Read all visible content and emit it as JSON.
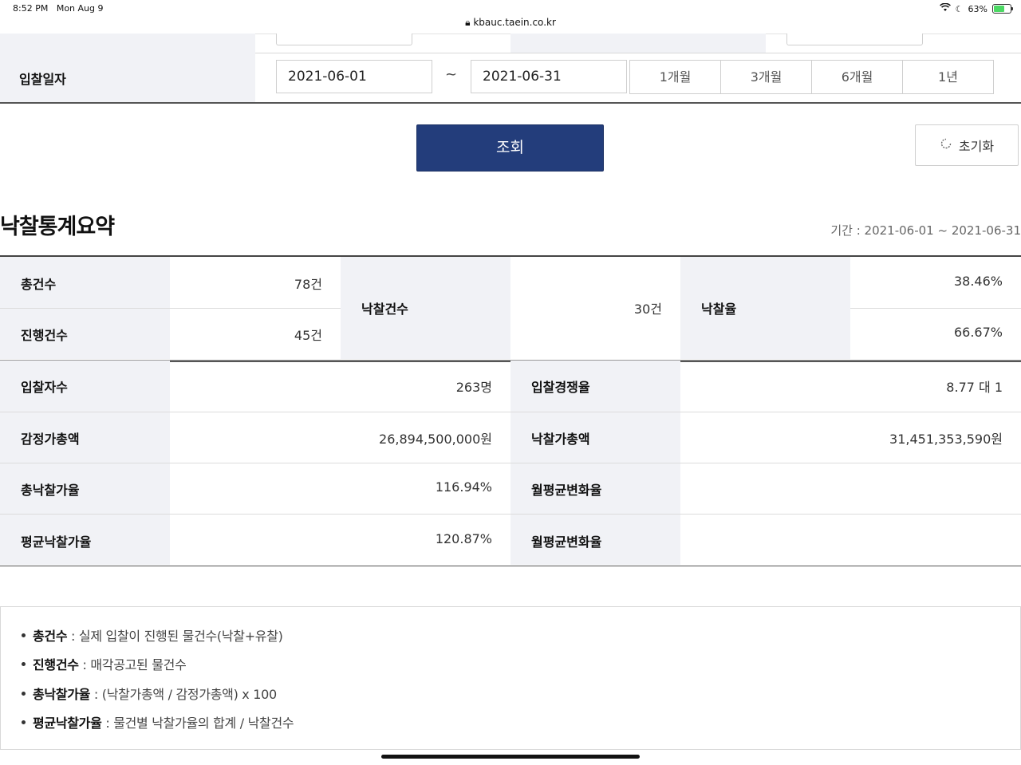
{
  "status_bar": {
    "time": "8:52 PM",
    "date": "Mon Aug 9",
    "url": "kbauc.taein.co.kr",
    "battery": "63%",
    "battery_level": 0.63
  },
  "filter": {
    "bid_date_label": "입찰일자",
    "start_date": "2021-06-01",
    "separator": "~",
    "end_date": "2021-06-31",
    "periods": [
      "1개월",
      "3개월",
      "6개월",
      "1년"
    ]
  },
  "actions": {
    "search_label": "조회",
    "reset_label": "초기화"
  },
  "summary": {
    "title": "낙찰통계요약",
    "period_label": "기간 : 2021-06-01 ~ 2021-06-31"
  },
  "table1": {
    "total_label": "총건수",
    "total_value": "78건",
    "progress_label": "진행건수",
    "progress_value": "45건",
    "won_label": "낙찰건수",
    "won_value": "30건",
    "rate_label": "낙찰율",
    "rate_value_1": "38.46%",
    "rate_value_2": "66.67%"
  },
  "table2": {
    "rows": [
      {
        "label_a": "입찰자수",
        "value_a": "263명",
        "label_b": "입찰경쟁율",
        "value_b": "8.77 대 1"
      },
      {
        "label_a": "감정가총액",
        "value_a": "26,894,500,000원",
        "label_b": "낙찰가총액",
        "value_b": "31,451,353,590원"
      },
      {
        "label_a": "총낙찰가율",
        "value_a": "116.94%",
        "label_b": "월평균변화율",
        "value_b": ""
      },
      {
        "label_a": "평균낙찰가율",
        "value_a": "120.87%",
        "label_b": "월평균변화율",
        "value_b": ""
      }
    ]
  },
  "notes": [
    {
      "term": "총건수",
      "desc": " : 실제 입찰이 진행된 물건수(낙찰+유찰)"
    },
    {
      "term": "진행건수",
      "desc": " : 매각공고된 물건수"
    },
    {
      "term": "총낙찰가율",
      "desc": " : (낙찰가총액 / 감정가총액) x 100"
    },
    {
      "term": "평균낙찰가율",
      "desc": " : 물건별 낙찰가율의 합계 / 낙찰건수"
    }
  ]
}
